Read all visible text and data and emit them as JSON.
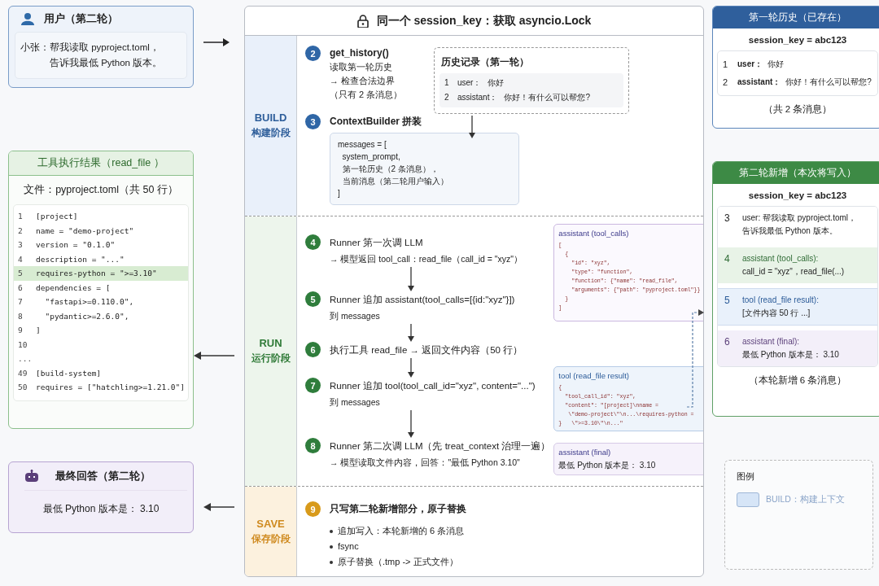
{
  "user_card": {
    "title": "用户（第二轮）",
    "speaker": "小张：",
    "message_lines": [
      "帮我读取 pyproject.toml，",
      "告诉我最低 Python 版本。"
    ]
  },
  "tool_result": {
    "title": "工具执行结果（read_file ）",
    "file_label": "文件：pyproject.toml（共 50 行）",
    "lines": [
      {
        "number": "1",
        "code": "[project]",
        "highlighted": false
      },
      {
        "number": "2",
        "code": "name = \"demo-project\"",
        "highlighted": false
      },
      {
        "number": "3",
        "code": "version = \"0.1.0\"",
        "highlighted": false
      },
      {
        "number": "4",
        "code": "description = \"...\"",
        "highlighted": false
      },
      {
        "number": "5",
        "code": "requires-python = \">=3.10\"",
        "highlighted": true
      },
      {
        "number": "6",
        "code": "dependencies = [",
        "highlighted": false
      },
      {
        "number": "7",
        "code": "  \"fastapi>=0.110.0\",",
        "highlighted": false
      },
      {
        "number": "8",
        "code": "  \"pydantic>=2.6.0\",",
        "highlighted": false
      },
      {
        "number": "9",
        "code": "]",
        "highlighted": false
      },
      {
        "number": "10",
        "highlighted": false
      },
      {
        "number": "...",
        "highlighted": false
      },
      {
        "number": "49",
        "code": "[build-system]",
        "highlighted": false
      },
      {
        "number": "50",
        "code": "requires = [\"hatchling>=1.21.0\"]",
        "highlighted": false
      }
    ]
  },
  "final_answer": {
    "title": "最终回答（第二轮）",
    "text": "最低 Python 版本是： 3.10"
  },
  "pipeline": {
    "title": "同一个 session_key：获取 asyncio.Lock",
    "phases": [
      {
        "kind": "build",
        "name": "BUILD",
        "label": "构建阶段",
        "steps": [
          {
            "number": "2",
            "lines": [
              "get_history()",
              "读取第一轮历史",
              "→ 检查合法边界",
              "（只有 2 条消息）"
            ]
          },
          {
            "number": "3",
            "lines": [
              "ContextBuilder 拼装"
            ],
            "code": [
              "messages = [",
              "  system_prompt,",
              "  第一轮历史（2 条消息），",
              "  当前消息（第二轮用户输入）",
              "]"
            ]
          }
        ],
        "history_box": {
          "title": "历史记录（第一轮）",
          "rows": [
            {
              "number": "1",
              "role": "user：",
              "text": "你好"
            },
            {
              "number": "2",
              "role": "assistant：",
              "text": "你好！有什么可以帮您?"
            }
          ]
        }
      },
      {
        "kind": "run",
        "name": "RUN",
        "label": "运行阶段",
        "steps": [
          {
            "number": "4",
            "lines": [
              "Runner 第一次调 LLM",
              "→ 模型返回 tool_call：read_file（call_id = \"xyz\"）"
            ]
          },
          {
            "number": "5",
            "lines": [
              "Runner 追加 assistant(tool_calls=[{id:\"xyz\"}])",
              "到 messages"
            ]
          },
          {
            "number": "6",
            "lines": [
              "执行工具 read_file → 返回文件内容（50 行）"
            ]
          },
          {
            "number": "7",
            "lines": [
              "Runner 追加 tool(tool_call_id=\"xyz\", content=\"...\")",
              "到 messages"
            ]
          },
          {
            "number": "8",
            "lines": [
              "Runner 第二次调 LLM（先 treat_context 治理一遍）",
              "→ 模型读取文件内容，回答：\"最低 Python 3.10\""
            ]
          }
        ],
        "message_boxes": [
          {
            "kind": "tool_calls",
            "title": "assistant (tool_calls)",
            "lines": [
              "[",
              "  {",
              "    \"id\": \"xyz\",",
              "    \"type\": \"function\",",
              "    \"function\": {\"name\": \"read_file\",",
              "    \"arguments\": {\"path\": \"pyproject.toml\"}}",
              "  }",
              "]"
            ]
          },
          {
            "kind": "tool",
            "title": "tool (read_file result)",
            "lines": [
              "{",
              "  \"tool_call_id\": \"xyz\",",
              "  \"content\": \"[project]\\nname =",
              "   \\\"demo-project\\\"\\n...\\requires-python =",
              "}   \\\">=3.10\\\"\\n...\""
            ]
          },
          {
            "kind": "final",
            "title": "assistant (final)",
            "lines": [
              "最低 Python 版本是： 3.10"
            ]
          }
        ]
      },
      {
        "kind": "save",
        "name": "SAVE",
        "label": "保存阶段",
        "steps": [
          {
            "number": "9",
            "lines": [
              "只写第二轮新增部分，原子替换"
            ],
            "bullets": [
              "追加写入：本轮新增的 6 条消息",
              "fsync",
              "原子替换（.tmp -> 正式文件）"
            ]
          }
        ]
      }
    ]
  },
  "first_round": {
    "title": "第一轮历史（已存在）",
    "session_key": "session_key = abc123",
    "messages": [
      {
        "number": "1",
        "role": "user：",
        "text": "你好"
      },
      {
        "number": "2",
        "role": "assistant：",
        "text": "你好！有什么可以帮您?"
      }
    ],
    "footer": "（共 2 条消息）"
  },
  "second_round": {
    "title": "第二轮新增（本次将写入）",
    "session_key": "session_key = abc123",
    "messages": [
      {
        "number": "3",
        "kind": "user",
        "lines": [
          "user: 帮我读取 pyproject.toml，",
          "告诉我最低 Python 版本。"
        ]
      },
      {
        "number": "4",
        "kind": "tool_calls",
        "lines": [
          "assistant (tool_calls):",
          "call_id = \"xyz\"，read_file(...)"
        ]
      },
      {
        "number": "5",
        "kind": "tool",
        "lines": [
          "tool (read_file result):",
          "[文件内容 50 行 ...]"
        ]
      },
      {
        "number": "6",
        "kind": "final",
        "lines": [
          "assistant (final):",
          "最低 Python 版本是： 3.10"
        ]
      }
    ],
    "footer": "（本轮新增 6 条消息）"
  },
  "legend": {
    "title": "图例",
    "items": [
      {
        "label": "BUILD：构建上下文",
        "color": "#d6e5f7"
      }
    ]
  }
}
